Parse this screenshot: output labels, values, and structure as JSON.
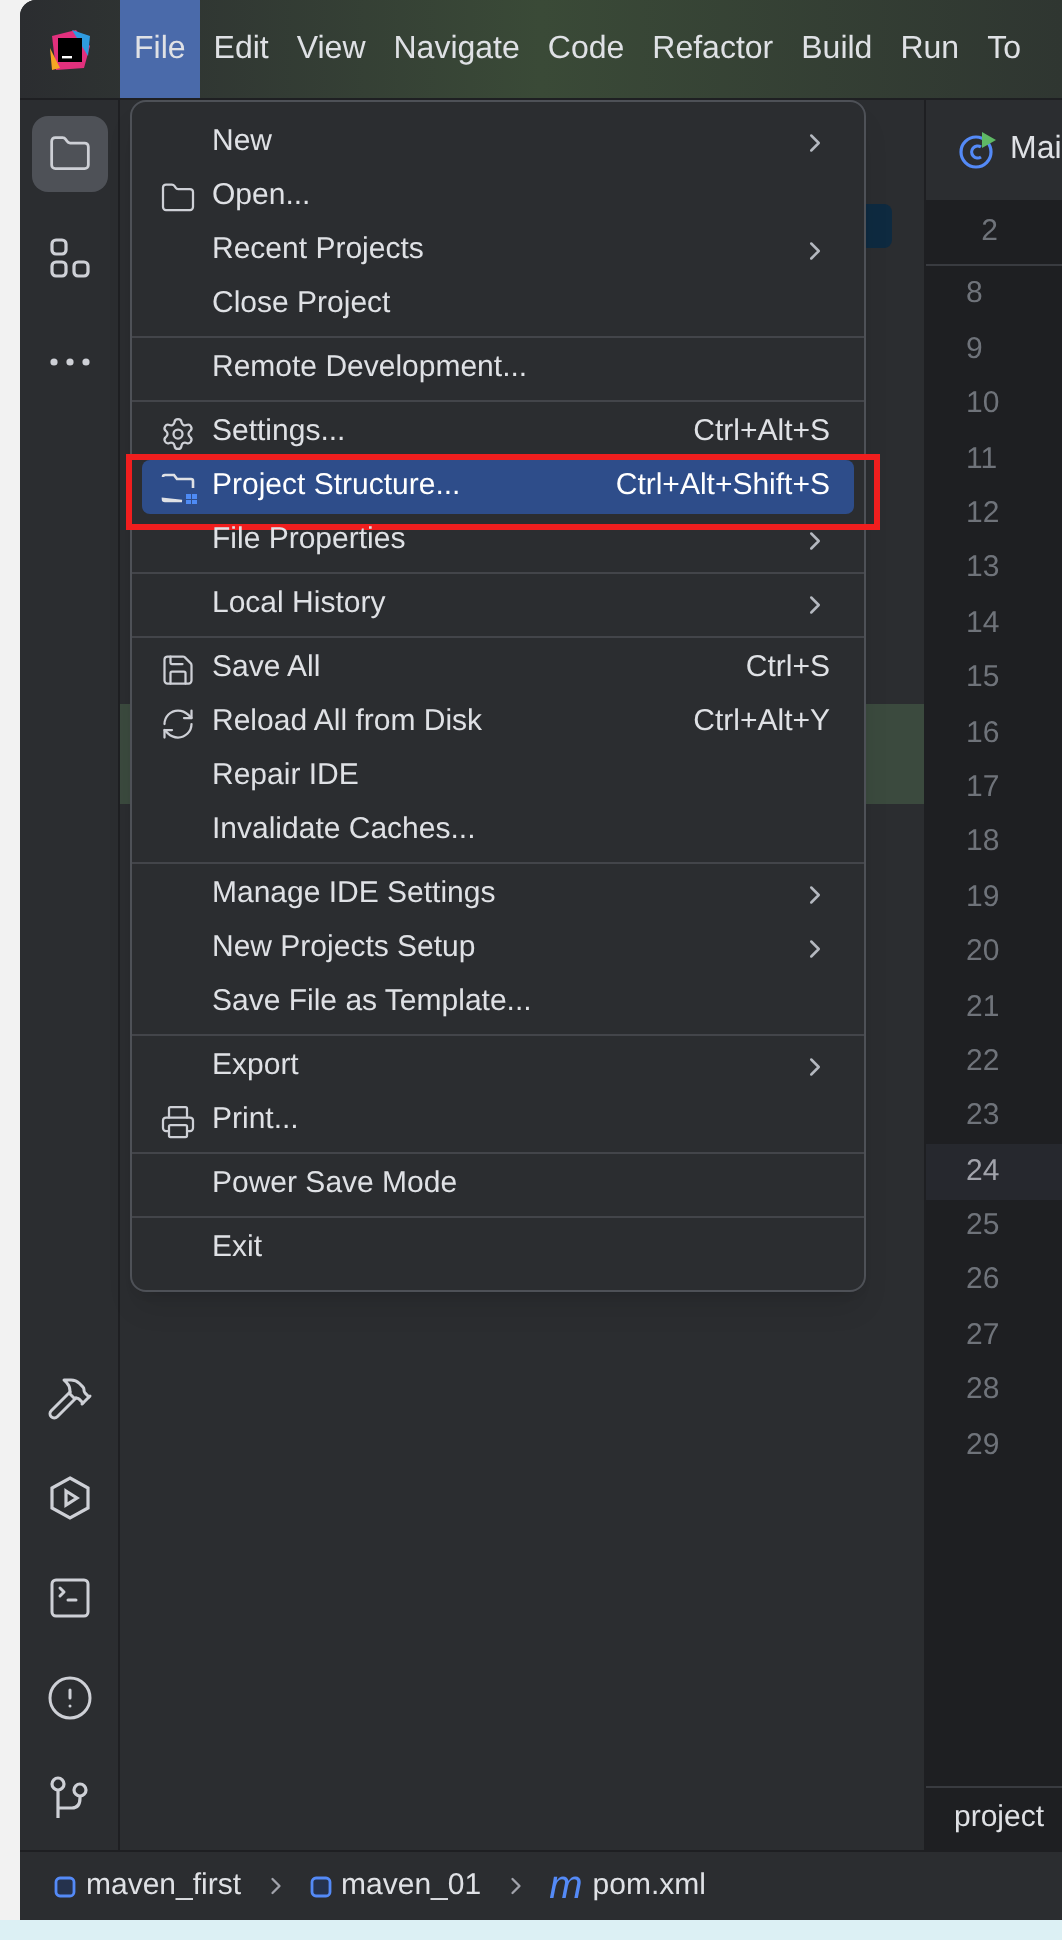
{
  "title_bar": {
    "menu": [
      {
        "label": "File",
        "selected": true
      },
      {
        "label": "Edit",
        "selected": false
      },
      {
        "label": "View",
        "selected": false
      },
      {
        "label": "Navigate",
        "selected": false
      },
      {
        "label": "Code",
        "selected": false
      },
      {
        "label": "Refactor",
        "selected": false
      },
      {
        "label": "Build",
        "selected": false
      },
      {
        "label": "Run",
        "selected": false
      },
      {
        "label": "To",
        "selected": false
      }
    ]
  },
  "tool_strip": {
    "top": [
      {
        "selected": true
      },
      {
        "selected": false
      },
      {
        "selected": false
      }
    ]
  },
  "editor": {
    "tab": "Mai",
    "sticky_line": "2",
    "line_numbers": [
      {
        "label": "8",
        "current": false
      },
      {
        "label": "9",
        "current": false
      },
      {
        "label": "10",
        "current": false
      },
      {
        "label": "11",
        "current": false
      },
      {
        "label": "12",
        "current": false
      },
      {
        "label": "13",
        "current": false
      },
      {
        "label": "14",
        "current": false
      },
      {
        "label": "15",
        "current": false
      },
      {
        "label": "16",
        "current": false
      },
      {
        "label": "17",
        "current": false
      },
      {
        "label": "18",
        "current": false
      },
      {
        "label": "19",
        "current": false
      },
      {
        "label": "20",
        "current": false
      },
      {
        "label": "21",
        "current": false
      },
      {
        "label": "22",
        "current": false
      },
      {
        "label": "23",
        "current": false
      },
      {
        "label": "24",
        "current": true
      },
      {
        "label": "25",
        "current": false
      },
      {
        "label": "26",
        "current": false
      },
      {
        "label": "27",
        "current": false
      },
      {
        "label": "28",
        "current": false
      },
      {
        "label": "29",
        "current": false
      }
    ],
    "breadcrumb": "project"
  },
  "file_menu": {
    "groups": [
      {
        "items": [
          {
            "label": "New",
            "submenu": true,
            "selected": false,
            "annotated": false
          },
          {
            "label": "Open...",
            "submenu": false,
            "selected": false,
            "annotated": false
          },
          {
            "label": "Recent Projects",
            "submenu": true,
            "selected": false,
            "annotated": false
          },
          {
            "label": "Close Project",
            "submenu": false,
            "selected": false,
            "annotated": false
          }
        ]
      },
      {
        "items": [
          {
            "label": "Remote Development...",
            "submenu": false,
            "selected": false,
            "annotated": false
          }
        ]
      },
      {
        "items": [
          {
            "label": "Settings...",
            "shortcut": "Ctrl+Alt+S",
            "submenu": false,
            "selected": false,
            "annotated": false
          },
          {
            "label": "Project Structure...",
            "shortcut": "Ctrl+Alt+Shift+S",
            "submenu": false,
            "selected": true,
            "annotated": true
          },
          {
            "label": "File Properties",
            "submenu": true,
            "selected": false,
            "annotated": false
          }
        ]
      },
      {
        "items": [
          {
            "label": "Local History",
            "submenu": true,
            "selected": false,
            "annotated": false
          }
        ]
      },
      {
        "items": [
          {
            "label": "Save All",
            "shortcut": "Ctrl+S",
            "submenu": false,
            "selected": false,
            "annotated": false
          },
          {
            "label": "Reload All from Disk",
            "shortcut": "Ctrl+Alt+Y",
            "submenu": false,
            "selected": false,
            "annotated": false
          },
          {
            "label": "Repair IDE",
            "submenu": false,
            "selected": false,
            "annotated": false
          },
          {
            "label": "Invalidate Caches...",
            "submenu": false,
            "selected": false,
            "annotated": false
          }
        ]
      },
      {
        "items": [
          {
            "label": "Manage IDE Settings",
            "submenu": true,
            "selected": false,
            "annotated": false
          },
          {
            "label": "New Projects Setup",
            "submenu": true,
            "selected": false,
            "annotated": false
          },
          {
            "label": "Save File as Template...",
            "submenu": false,
            "selected": false,
            "annotated": false
          }
        ]
      },
      {
        "items": [
          {
            "label": "Export",
            "submenu": true,
            "selected": false,
            "annotated": false
          },
          {
            "label": "Print...",
            "submenu": false,
            "selected": false,
            "annotated": false
          }
        ]
      },
      {
        "items": [
          {
            "label": "Power Save Mode",
            "submenu": false,
            "selected": false,
            "annotated": false
          }
        ]
      },
      {
        "items": [
          {
            "label": "Exit",
            "submenu": false,
            "selected": false,
            "annotated": false
          }
        ]
      }
    ]
  },
  "status_bar": {
    "breadcrumbs": [
      {
        "kind": "module",
        "label": "maven_first"
      },
      {
        "kind": "module",
        "label": "maven_01"
      },
      {
        "kind": "maven",
        "icon_text": "m",
        "label": "pom.xml"
      }
    ]
  }
}
